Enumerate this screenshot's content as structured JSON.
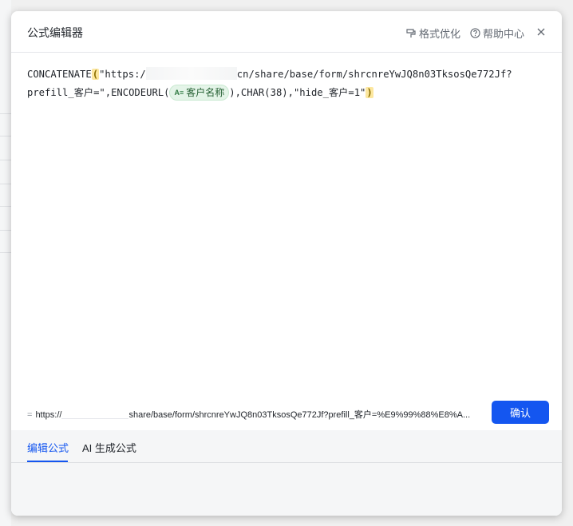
{
  "dialog": {
    "title": "公式编辑器",
    "actions": {
      "format": "格式优化",
      "help": "帮助中心"
    }
  },
  "editor": {
    "fn_concat": "CONCATENATE",
    "open_paren": "(",
    "str1_prefix": "\"https:/",
    "str1_suffix": "cn/share/base/form/shrcnreYwJQ8n03TksosQe772Jf?",
    "str1_line2": "prefill_客户=\",ENCODEURL(",
    "field_icon": "A≡",
    "field_name": "客户名称",
    "after_field": "),CHAR(38),\"hide_客户=1\"",
    "close_paren": ")"
  },
  "result": {
    "eq": "=",
    "prefix": "https://",
    "suffix": "share/base/form/shrcnreYwJQ8n03TksosQe772Jf?prefill_客户=%E9%99%88%E8%A..."
  },
  "confirm_label": "确认",
  "tabs": [
    {
      "label": "编辑公式",
      "active": true
    },
    {
      "label": "AI 生成公式",
      "active": false
    }
  ],
  "colors": {
    "accent": "#1456f0",
    "paren_highlight": "#fce79f",
    "field_chip_bg": "#e4f4e8"
  }
}
